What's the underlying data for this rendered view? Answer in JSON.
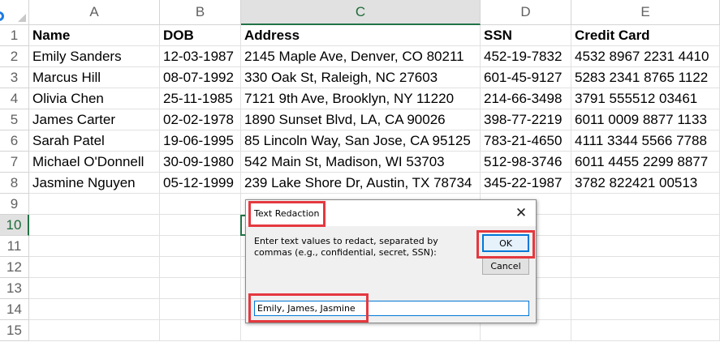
{
  "columns": [
    "A",
    "B",
    "C",
    "D",
    "E"
  ],
  "rows": [
    "1",
    "2",
    "3",
    "4",
    "5",
    "6",
    "7",
    "8",
    "9",
    "10",
    "11",
    "12",
    "13",
    "14",
    "15"
  ],
  "header": [
    "Name",
    "DOB",
    "Address",
    "SSN",
    "Credit Card"
  ],
  "data": [
    [
      "Emily Sanders",
      "12-03-1987",
      "2145 Maple Ave, Denver, CO 80211",
      "452-19-7832",
      "4532 8967 2231 4410"
    ],
    [
      "Marcus Hill",
      "08-07-1992",
      "330 Oak St, Raleigh, NC 27603",
      "601-45-9127",
      "5283 2341 8765 1122"
    ],
    [
      "Olivia Chen",
      "25-11-1985",
      "7121 9th Ave, Brooklyn, NY 11220",
      "214-66-3498",
      "3791 555512 03461"
    ],
    [
      "James Carter",
      "02-02-1978",
      "1890 Sunset Blvd, LA, CA 90026",
      "398-77-2219",
      "6011 0009 8877 1133"
    ],
    [
      "Sarah Patel",
      "19-06-1995",
      "85 Lincoln Way, San Jose, CA 95125",
      "783-21-4650",
      "4111 3344 5566 7788"
    ],
    [
      "Michael O'Donnell",
      "30-09-1980",
      "542 Main St, Madison, WI 53703",
      "512-98-3746",
      "6011 4455 2299 8877"
    ],
    [
      "Jasmine Nguyen",
      "05-12-1999",
      "239 Lake Shore Dr, Austin, TX 78734",
      "345-22-1987",
      "3782 822421 00513"
    ]
  ],
  "dialog": {
    "title": "Text Redaction",
    "close_glyph": "✕",
    "prompt": "Enter text values to redact, separated by commas (e.g., confidential, secret, SSN):",
    "ok_label": "OK",
    "cancel_label": "Cancel",
    "input_value": "Emily, James, Jasmine"
  },
  "colors": {
    "highlight": "#e4383f",
    "selection": "#217346"
  }
}
